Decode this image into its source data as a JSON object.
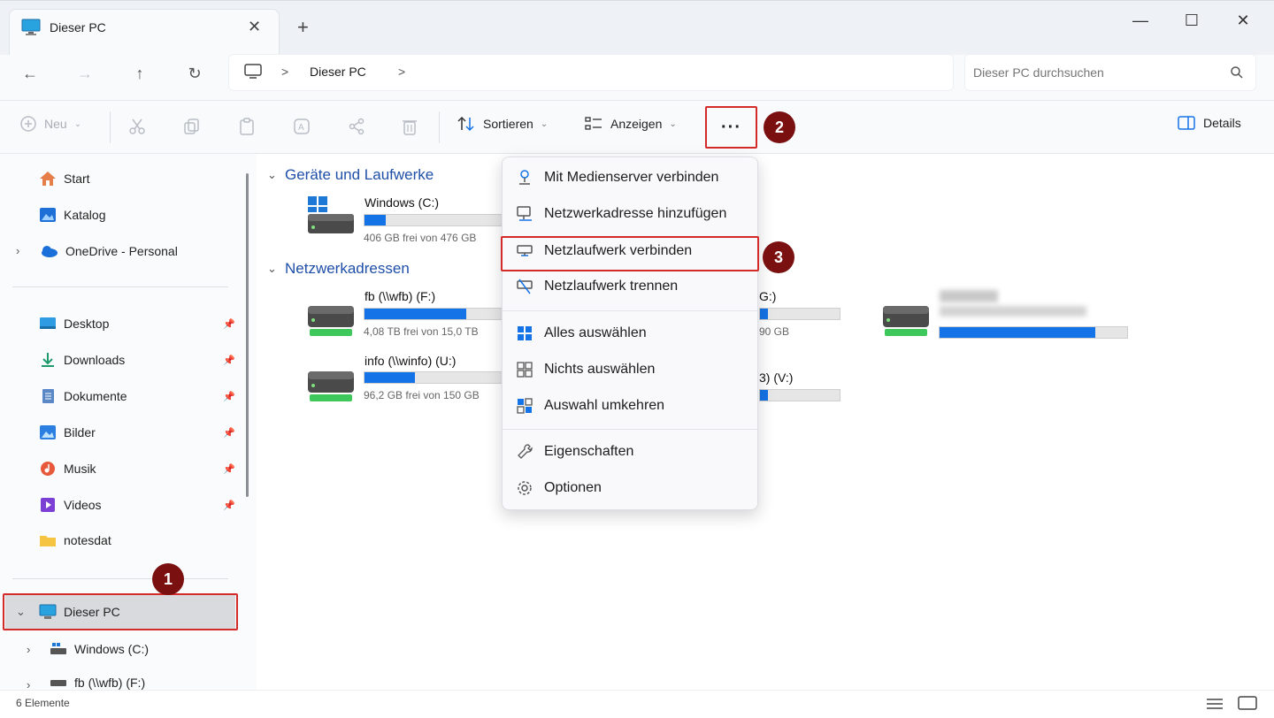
{
  "window": {
    "tab_title": "Dieser PC",
    "tab_close": "✕",
    "tab_new": "+",
    "min": "—",
    "max": "☐",
    "close": "✕"
  },
  "nav_buttons": {
    "back": "←",
    "forward": "→",
    "up": "↑",
    "refresh": "↻"
  },
  "address": {
    "sep1": ">",
    "location": "Dieser PC",
    "sep2": ">"
  },
  "search": {
    "placeholder": "Dieser PC durchsuchen"
  },
  "toolbar": {
    "new_label": "Neu",
    "sort_label": "Sortieren",
    "view_label": "Anzeigen",
    "more_label": "···",
    "details_label": "Details"
  },
  "sidebar": {
    "quick": [
      {
        "label": "Start"
      },
      {
        "label": "Katalog"
      },
      {
        "label": "OneDrive - Personal"
      }
    ],
    "pinned": [
      {
        "label": "Desktop"
      },
      {
        "label": "Downloads"
      },
      {
        "label": "Dokumente"
      },
      {
        "label": "Bilder"
      },
      {
        "label": "Musik"
      },
      {
        "label": "Videos"
      },
      {
        "label": "notesdat"
      }
    ],
    "this_pc": "Dieser PC",
    "children": [
      {
        "label": "Windows (C:)"
      },
      {
        "label": "fb (\\\\wfb) (F:)"
      }
    ]
  },
  "content": {
    "group1": "Geräte und Laufwerke",
    "group2": "Netzwerkadressen",
    "drives": [
      {
        "name": "Windows (C:)",
        "free": "406 GB frei von 476 GB",
        "usage": 0.15
      },
      {
        "name": "fb (\\\\wfb) (F:)",
        "free": "4,08 TB frei von 15,0 TB",
        "usage": 0.73
      },
      {
        "name": "info (\\\\winfo) (U:)",
        "free": "96,2 GB frei von 150 GB",
        "usage": 0.36
      }
    ],
    "partial": [
      {
        "name": "G:)",
        "free": "90 GB",
        "usage": 0.1
      },
      {
        "name": "3) (V:)",
        "usage": 0.1
      }
    ],
    "blurred_usage": 0.83
  },
  "menu": {
    "items": [
      {
        "label": "Mit Medienserver verbinden"
      },
      {
        "label": "Netzwerkadresse hinzufügen"
      },
      {
        "label": "Netzlaufwerk verbinden"
      },
      {
        "label": "Netzlaufwerk trennen"
      },
      {
        "label": "Alles auswählen"
      },
      {
        "label": "Nichts auswählen"
      },
      {
        "label": "Auswahl umkehren"
      },
      {
        "label": "Eigenschaften"
      },
      {
        "label": "Optionen"
      }
    ]
  },
  "badges": {
    "b1": "1",
    "b2": "2",
    "b3": "3"
  },
  "status": {
    "count": "6 Elemente"
  },
  "colors": {
    "accent": "#1473e6",
    "badge": "#7a1010",
    "highlight": "#d42a2a"
  }
}
